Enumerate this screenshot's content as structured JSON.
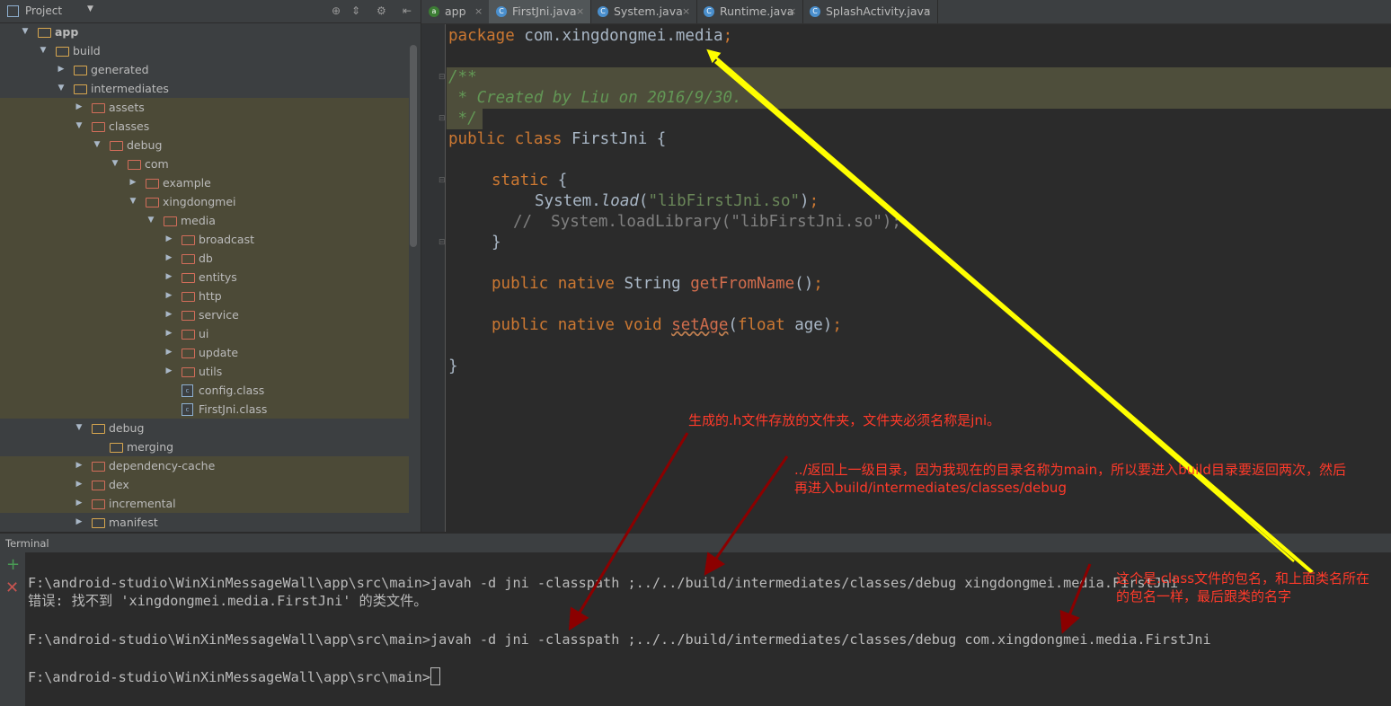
{
  "project": {
    "title": "Project",
    "tree": [
      {
        "label": "app",
        "depth": 0,
        "arrow": "▼",
        "bold": true,
        "kind": "module",
        "hl": false
      },
      {
        "label": "build",
        "depth": 1,
        "arrow": "▼",
        "kind": "folder",
        "hl": false
      },
      {
        "label": "generated",
        "depth": 2,
        "arrow": "▶",
        "kind": "folder",
        "hl": false
      },
      {
        "label": "intermediates",
        "depth": 2,
        "arrow": "▼",
        "kind": "folder",
        "hl": false
      },
      {
        "label": "assets",
        "depth": 3,
        "arrow": "▶",
        "kind": "folder-red",
        "hl": true
      },
      {
        "label": "classes",
        "depth": 3,
        "arrow": "▼",
        "kind": "folder-red",
        "hl": true
      },
      {
        "label": "debug",
        "depth": 4,
        "arrow": "▼",
        "kind": "folder-red",
        "hl": true
      },
      {
        "label": "com",
        "depth": 5,
        "arrow": "▼",
        "kind": "folder-red",
        "hl": true
      },
      {
        "label": "example",
        "depth": 6,
        "arrow": "▶",
        "kind": "folder-red",
        "hl": true
      },
      {
        "label": "xingdongmei",
        "depth": 6,
        "arrow": "▼",
        "kind": "folder-red",
        "hl": true
      },
      {
        "label": "media",
        "depth": 7,
        "arrow": "▼",
        "kind": "folder-red",
        "hl": true
      },
      {
        "label": "broadcast",
        "depth": 8,
        "arrow": "▶",
        "kind": "folder-red",
        "hl": true
      },
      {
        "label": "db",
        "depth": 8,
        "arrow": "▶",
        "kind": "folder-red",
        "hl": true
      },
      {
        "label": "entitys",
        "depth": 8,
        "arrow": "▶",
        "kind": "folder-red",
        "hl": true
      },
      {
        "label": "http",
        "depth": 8,
        "arrow": "▶",
        "kind": "folder-red",
        "hl": true
      },
      {
        "label": "service",
        "depth": 8,
        "arrow": "▶",
        "kind": "folder-red",
        "hl": true
      },
      {
        "label": "ui",
        "depth": 8,
        "arrow": "▶",
        "kind": "folder-red",
        "hl": true
      },
      {
        "label": "update",
        "depth": 8,
        "arrow": "▶",
        "kind": "folder-red",
        "hl": true
      },
      {
        "label": "utils",
        "depth": 8,
        "arrow": "▶",
        "kind": "folder-red",
        "hl": true
      },
      {
        "label": "config.class",
        "depth": 8,
        "arrow": "",
        "kind": "file",
        "hl": true
      },
      {
        "label": "FirstJni.class",
        "depth": 8,
        "arrow": "",
        "kind": "file",
        "hl": true
      },
      {
        "label": "debug",
        "depth": 3,
        "arrow": "▼",
        "kind": "folder",
        "hl": false
      },
      {
        "label": "merging",
        "depth": 4,
        "arrow": "",
        "kind": "folder",
        "hl": false
      },
      {
        "label": "dependency-cache",
        "depth": 3,
        "arrow": "▶",
        "kind": "folder-red",
        "hl": true
      },
      {
        "label": "dex",
        "depth": 3,
        "arrow": "▶",
        "kind": "folder-red",
        "hl": true
      },
      {
        "label": "incremental",
        "depth": 3,
        "arrow": "▶",
        "kind": "folder-red",
        "hl": true
      },
      {
        "label": "manifest",
        "depth": 3,
        "arrow": "▶",
        "kind": "folder",
        "hl": false
      }
    ]
  },
  "tabs": [
    {
      "label": "app",
      "icon": "android-icon",
      "active": false
    },
    {
      "label": "FirstJni.java",
      "icon": "class-icon",
      "active": true
    },
    {
      "label": "System.java",
      "icon": "class-icon",
      "active": false
    },
    {
      "label": "Runtime.java",
      "icon": "class-icon",
      "active": false
    },
    {
      "label": "SplashActivity.java",
      "icon": "class-icon",
      "active": false
    }
  ],
  "code": {
    "package_kw": "package",
    "package_name": " com.xingdongmei.media",
    "semicolon": ";",
    "comment_open": "/**",
    "comment_body": " * Created by Liu on 2016/9/30.",
    "comment_close": " */",
    "class_kw": "public class",
    "class_name": " FirstJni {",
    "static_kw": "static",
    "static_brace": " {",
    "load_obj": "System.",
    "load_fn": "load",
    "load_open": "(",
    "load_str": "\"libFirstJni.so\"",
    "load_close": ")",
    "commented_load": "//  System.loadLibrary(\"libFirstJni.so\");",
    "static_end": "}",
    "m1_kw": "public native",
    "m1_type": " String ",
    "m1_name": "getFromName",
    "m1_rest": "()",
    "m2_kw": "public native void",
    "m2_name": "setAge",
    "m2_open": "(",
    "m2_kw2": "float",
    "m2_rest": " age)",
    "class_end": "}"
  },
  "terminal": {
    "title": "Terminal",
    "lines": [
      "F:\\android-studio\\WinXinMessageWall\\app\\src\\main>javah -d jni -classpath ;../../build/intermediates/classes/debug xingdongmei.media.FirstJni",
      "错误: 找不到 'xingdongmei.media.FirstJni' 的类文件。",
      "F:\\android-studio\\WinXinMessageWall\\app\\src\\main>javah -d jni -classpath ;../../build/intermediates/classes/debug com.xingdongmei.media.FirstJni",
      "F:\\android-studio\\WinXinMessageWall\\app\\src\\main>"
    ]
  },
  "annotations": {
    "note1": "生成的.h文件存放的文件夹，文件夹必须名称是jni。",
    "note2_line1": "../返回上一级目录，因为我现在的目录名称为main，所以要进入build目录要返回两次，然后",
    "note2_line2": "再进入build/intermediates/classes/debug",
    "note3_line1": "这个是.class文件的包名，和上面类名所在",
    "note3_line2": "的包名一样，最后跟类的名字",
    "red": "#ff3a2a",
    "arrow_red": "#8b0000",
    "arrow_yellow": "#ffff00"
  }
}
